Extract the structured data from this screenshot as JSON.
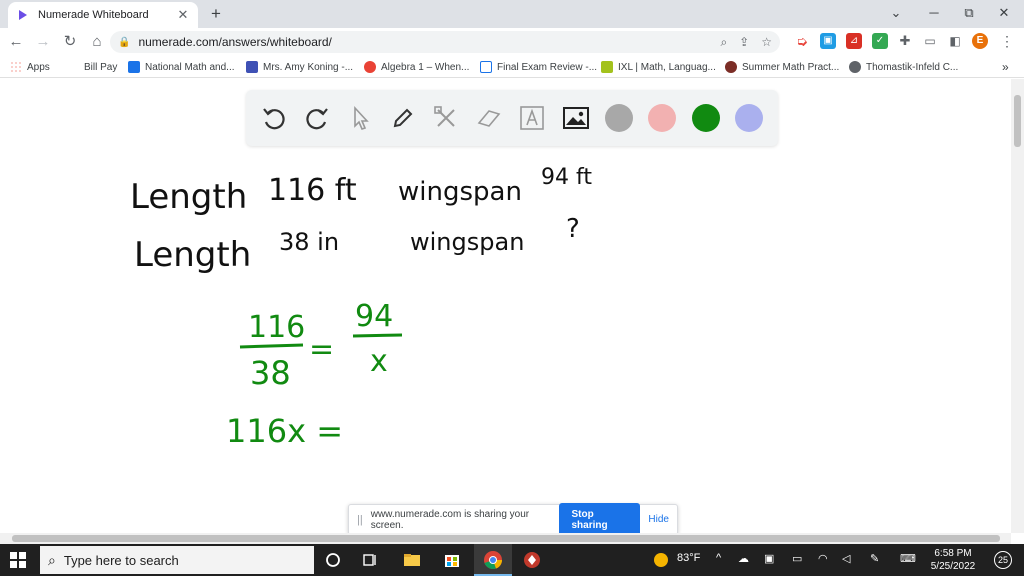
{
  "browser": {
    "tab_title": "Numerade Whiteboard",
    "tab_close": "✕",
    "new_tab": "+",
    "url": "numerade.com/answers/whiteboard/",
    "window_controls": {
      "minimize": "⌄",
      "maximize": "─",
      "restore": "⧉",
      "close": "✕"
    },
    "profile_initial": "E",
    "menu_more": "⋮"
  },
  "bookmarks": [
    {
      "label": "Apps"
    },
    {
      "label": "Bill Pay"
    },
    {
      "label": "National Math and..."
    },
    {
      "label": "Mrs. Amy Koning -..."
    },
    {
      "label": "Algebra 1 – When..."
    },
    {
      "label": "Final Exam Review -..."
    },
    {
      "label": "IXL | Math, Languag..."
    },
    {
      "label": "Summer Math Pract..."
    },
    {
      "label": "Thomastik-Infeld C..."
    }
  ],
  "bookmarks_more": "»",
  "whiteboard": {
    "tools": [
      "undo-icon",
      "redo-icon",
      "cursor-icon",
      "pen-icon",
      "tools-icon",
      "eraser-icon",
      "text-icon",
      "image-icon"
    ],
    "swatches": [
      "#a8a8a8",
      "#f2b1b1",
      "#118a11",
      "#aab0ee"
    ],
    "handwriting": {
      "line1_a": "Length",
      "line1_b": "116 ft",
      "line1_c": "wingspan",
      "line1_d": "94 ft",
      "line2_a": "Length",
      "line2_b": "38 in",
      "line2_c": "wingspan",
      "line2_d": "?",
      "frac1_num": "116",
      "frac1_den": "38",
      "equals": "=",
      "frac2_num": "94",
      "frac2_den": "x",
      "eq2": "116x ="
    },
    "ink_black": "#111111",
    "ink_green": "#118a11"
  },
  "share_banner": {
    "grip": "||",
    "message": "www.numerade.com is sharing your screen.",
    "stop_label": "Stop sharing",
    "hide_label": "Hide"
  },
  "taskbar": {
    "search_placeholder": "Type here to search",
    "weather": "83°F",
    "time": "6:58 PM",
    "date": "5/25/2022",
    "notifications": "25"
  }
}
